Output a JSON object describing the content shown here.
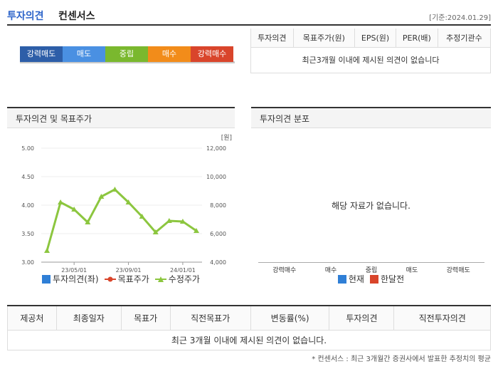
{
  "header": {
    "title_blue": "투자의견",
    "title_dark": "컨센서스",
    "date": "[기준:2024.01.29]"
  },
  "scale": [
    {
      "label": "강력매도",
      "color": "#2d5ea8"
    },
    {
      "label": "매도",
      "color": "#4a90e2"
    },
    {
      "label": "중립",
      "color": "#7ab82e"
    },
    {
      "label": "매수",
      "color": "#f28c1a"
    },
    {
      "label": "강력매수",
      "color": "#d9452b"
    }
  ],
  "consensus": {
    "headers": [
      "투자의견",
      "목표주가(원)",
      "EPS(원)",
      "PER(배)",
      "추정기관수"
    ],
    "empty": "최근3개월 이내에 제시된 의견이 없습니다"
  },
  "left_panel": {
    "title": "투자의견 및 목표주가",
    "unit": "[원]",
    "legend": [
      "투자의견(좌)",
      "목표주가",
      "수정주가"
    ]
  },
  "right_panel": {
    "title": "투자의견 분포",
    "empty": "해당 자료가 없습니다.",
    "categories": [
      "강력매수",
      "매수",
      "중립",
      "매도",
      "강력매도"
    ],
    "legend": [
      "현재",
      "한달전"
    ]
  },
  "chart_data": {
    "type": "line",
    "x": [
      "2023-03",
      "2023-04",
      "2023-05",
      "2023-06",
      "2023-07",
      "2023-08",
      "2023-09",
      "2023-10",
      "2023-11",
      "2023-12",
      "2024-01",
      "2024-02"
    ],
    "xticks": [
      "23/05/01",
      "23/09/01",
      "24/01/01"
    ],
    "y_left_ticks": [
      "5.00",
      "4.50",
      "4.00",
      "3.50",
      "3.00"
    ],
    "y_right_ticks": [
      "12,000",
      "10,000",
      "8,000",
      "6,000",
      "4,000"
    ],
    "ylim_left": [
      3.0,
      5.0
    ],
    "ylim_right": [
      4000,
      12000
    ],
    "series": [
      {
        "name": "수정주가",
        "color": "#8cc63f",
        "values": [
          4800,
          8200,
          7700,
          6800,
          8600,
          9100,
          8200,
          7200,
          6100,
          6900,
          6850,
          6200
        ]
      }
    ]
  },
  "bottom_table": {
    "headers": [
      "제공처",
      "최종일자",
      "목표가",
      "직전목표가",
      "변동률(%)",
      "투자의견",
      "직전투자의견"
    ],
    "empty": "최근 3개월 이내에 제시된 의견이 없습니다."
  },
  "footnote": "* 컨센서스 : 최근 3개월간 증권사에서 발표한 추정치의 평균"
}
